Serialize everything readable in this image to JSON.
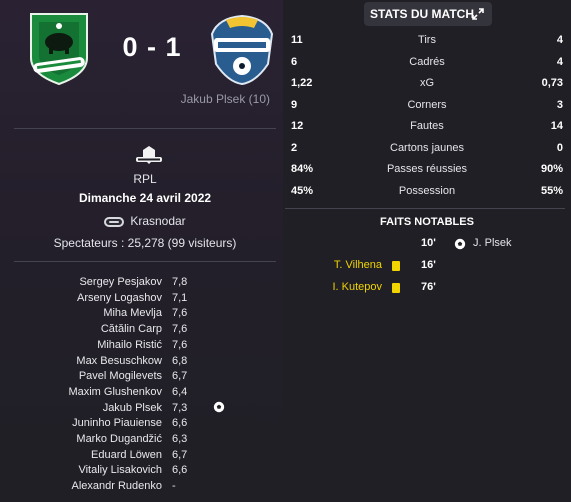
{
  "match": {
    "home_score": "0",
    "separator": "-",
    "away_score": "1",
    "score_text": "0 - 1",
    "away_scorer": "Jakub Plsek (10)"
  },
  "info": {
    "competition": "RPL",
    "date": "Dimanche 24 avril 2022",
    "stadium": "Krasnodar",
    "attendance": "Spectateurs : 25,278 (99 visiteurs)"
  },
  "players": [
    {
      "name": "Sergey Pesjakov",
      "rating": "7,8",
      "goal": false
    },
    {
      "name": "Arseny Logashov",
      "rating": "7,1",
      "goal": false
    },
    {
      "name": "Miha Mevlja",
      "rating": "7,6",
      "goal": false
    },
    {
      "name": "Cătălin Carp",
      "rating": "7,6",
      "goal": false
    },
    {
      "name": "Mihailo Ristić",
      "rating": "7,6",
      "goal": false
    },
    {
      "name": "Max Besuschkow",
      "rating": "6,8",
      "goal": false
    },
    {
      "name": "Pavel Mogilevets",
      "rating": "6,7",
      "goal": false
    },
    {
      "name": "Maxim Glushenkov",
      "rating": "6,4",
      "goal": false
    },
    {
      "name": "Jakub Plsek",
      "rating": "7,3",
      "goal": true
    },
    {
      "name": "Juninho Piauiense",
      "rating": "6,6",
      "goal": false
    },
    {
      "name": "Marko Dugandžić",
      "rating": "6,3",
      "goal": false
    },
    {
      "name": "Eduard Löwen",
      "rating": "6,7",
      "goal": false
    },
    {
      "name": "Vitaliy Lisakovich",
      "rating": "6,6",
      "goal": false
    },
    {
      "name": "Alexandr Rudenko",
      "rating": "-",
      "goal": false
    }
  ],
  "stats_tab": {
    "label": "STATS DU MATCH"
  },
  "stats": [
    {
      "home": "11",
      "label": "Tirs",
      "away": "4"
    },
    {
      "home": "6",
      "label": "Cadrés",
      "away": "4"
    },
    {
      "home": "1,22",
      "label": "xG",
      "away": "0,73"
    },
    {
      "home": "9",
      "label": "Corners",
      "away": "3"
    },
    {
      "home": "12",
      "label": "Fautes",
      "away": "14"
    },
    {
      "home": "2",
      "label": "Cartons jaunes",
      "away": "0"
    },
    {
      "home": "84%",
      "label": "Passes réussies",
      "away": "90%"
    },
    {
      "home": "45%",
      "label": "Possession",
      "away": "55%"
    }
  ],
  "notable": {
    "title": "FAITS NOTABLES",
    "events": [
      {
        "side": "away",
        "type": "goal",
        "minute": "10'",
        "player": "J. Plsek"
      },
      {
        "side": "home",
        "type": "yellow-card",
        "minute": "16'",
        "player": "T. Vilhena"
      },
      {
        "side": "home",
        "type": "yellow-card",
        "minute": "76'",
        "player": "I. Kutepov"
      }
    ]
  },
  "colors": {
    "card_yellow": "#f1d400",
    "home_crest_green": "#1a8a3c",
    "away_crest_blue": "#2a5d8f"
  }
}
